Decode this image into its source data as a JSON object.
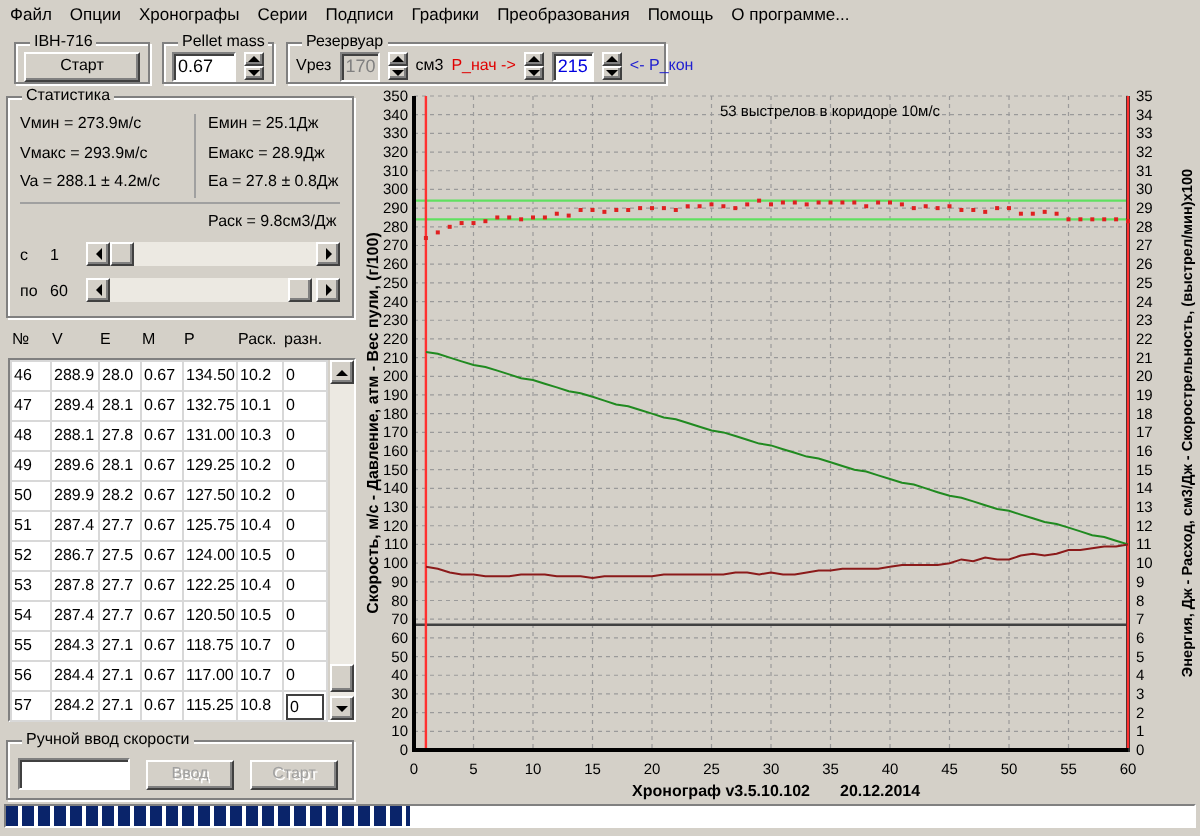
{
  "menu": [
    "Файл",
    "Опции",
    "Хронографы",
    "Серии",
    "Подписи",
    "Графики",
    "Преобразования",
    "Помощь",
    "О программе..."
  ],
  "device": {
    "title": "IBH-716",
    "button": "Старт"
  },
  "pellet_mass": {
    "title": "Pellet mass",
    "value": "0.67"
  },
  "reservoir": {
    "title": "Резервуар",
    "volume_label": "Vрез",
    "volume": "170",
    "volume_disabled": true,
    "unit": "см3",
    "p_start_label": "P_нач ->",
    "p_end": "215",
    "p_end_label": "<- P_кон"
  },
  "statistics": {
    "title": "Статистика",
    "velocity": [
      "Vмин = 273.9м/с",
      "Vмакс = 293.9м/с",
      "Va = 288.1 ± 4.2м/с"
    ],
    "energy": [
      "Емин = 25.1Дж",
      "Емакс = 28.9Дж",
      "Еа = 27.8 ± 0.8Дж"
    ],
    "consumption": "Раск = 9.8см3/Дж",
    "range": [
      {
        "label": "с",
        "value": "1",
        "level": 0
      },
      {
        "label": "по",
        "value": "60",
        "level": 1
      }
    ]
  },
  "table": {
    "columns": [
      "№",
      "V",
      "E",
      "M",
      "P",
      "Раск.",
      "разн."
    ],
    "rows": [
      {
        "cells": [
          "46",
          "288.9",
          "28.0",
          "0.67",
          "134.50",
          "10.2",
          "0"
        ],
        "editing": false
      },
      {
        "cells": [
          "47",
          "289.4",
          "28.1",
          "0.67",
          "132.75",
          "10.1",
          "0"
        ],
        "editing": false
      },
      {
        "cells": [
          "48",
          "288.1",
          "27.8",
          "0.67",
          "131.00",
          "10.3",
          "0"
        ],
        "editing": false
      },
      {
        "cells": [
          "49",
          "289.6",
          "28.1",
          "0.67",
          "129.25",
          "10.2",
          "0"
        ],
        "editing": false
      },
      {
        "cells": [
          "50",
          "289.9",
          "28.2",
          "0.67",
          "127.50",
          "10.2",
          "0"
        ],
        "editing": false
      },
      {
        "cells": [
          "51",
          "287.4",
          "27.7",
          "0.67",
          "125.75",
          "10.4",
          "0"
        ],
        "editing": false
      },
      {
        "cells": [
          "52",
          "286.7",
          "27.5",
          "0.67",
          "124.00",
          "10.5",
          "0"
        ],
        "editing": false
      },
      {
        "cells": [
          "53",
          "287.8",
          "27.7",
          "0.67",
          "122.25",
          "10.4",
          "0"
        ],
        "editing": false
      },
      {
        "cells": [
          "54",
          "287.4",
          "27.7",
          "0.67",
          "120.50",
          "10.5",
          "0"
        ],
        "editing": false
      },
      {
        "cells": [
          "55",
          "284.3",
          "27.1",
          "0.67",
          "118.75",
          "10.7",
          "0"
        ],
        "editing": false
      },
      {
        "cells": [
          "56",
          "284.4",
          "27.1",
          "0.67",
          "117.00",
          "10.7",
          "0"
        ],
        "editing": false
      },
      {
        "cells": [
          "57",
          "284.2",
          "27.1",
          "0.67",
          "115.25",
          "10.8",
          "0"
        ],
        "editing": true
      }
    ]
  },
  "manual_entry": {
    "title": "Ручной ввод скорости",
    "buttons": [
      {
        "label": "Ввод",
        "disabled": true
      },
      {
        "label": "Старт",
        "disabled": true
      }
    ]
  },
  "chart": {
    "chart_data": {
      "type": "line",
      "xlabel": "Хронограф v3.5.10.102",
      "ylabel": "Скорость, м/с - Давление, атм - Вес пули, (г/100)",
      "xlim": [
        0,
        60
      ],
      "ylim": [
        0,
        350
      ],
      "xticks": [
        0,
        5,
        10,
        15,
        20,
        25,
        30,
        35,
        40,
        45,
        50,
        55,
        60
      ],
      "yticks": [
        0,
        10,
        20,
        30,
        40,
        50,
        60,
        70,
        80,
        90,
        100,
        110,
        120,
        130,
        140,
        150,
        160,
        170,
        180,
        190,
        200,
        210,
        220,
        230,
        240,
        250,
        260,
        270,
        280,
        290,
        300,
        310,
        320,
        330,
        340,
        350
      ],
      "x": [
        1,
        2,
        3,
        4,
        5,
        6,
        7,
        8,
        9,
        10,
        11,
        12,
        13,
        14,
        15,
        16,
        17,
        18,
        19,
        20,
        21,
        22,
        23,
        24,
        25,
        26,
        27,
        28,
        29,
        30,
        31,
        32,
        33,
        34,
        35,
        36,
        37,
        38,
        39,
        40,
        41,
        42,
        43,
        44,
        45,
        46,
        47,
        48,
        49,
        50,
        51,
        52,
        53,
        54,
        55,
        56,
        57,
        58,
        59,
        60
      ],
      "series": [
        {
          "type": "scatter",
          "color": "#e02020",
          "values": [
            274,
            277,
            280,
            282,
            282,
            283,
            285,
            285,
            284,
            285,
            285,
            287,
            286,
            289,
            289,
            288,
            289,
            289,
            290,
            290,
            290,
            289,
            291,
            291,
            292,
            291,
            290,
            292,
            294,
            292,
            293,
            293,
            292,
            293,
            293,
            293,
            293,
            291,
            293,
            293,
            292,
            290,
            291,
            290,
            291,
            289,
            289,
            288,
            290,
            290,
            287,
            287,
            288,
            287,
            284,
            284,
            284,
            284,
            284,
            283
          ]
        },
        {
          "type": "line",
          "color": "#208a20",
          "values": [
            213,
            212,
            210,
            208,
            206,
            205,
            203,
            201,
            199,
            198,
            196,
            194,
            192,
            191,
            189,
            187,
            185,
            184,
            182,
            180,
            178,
            177,
            175,
            173,
            171,
            170,
            168,
            166,
            164,
            163,
            161,
            159,
            157,
            156,
            154,
            152,
            150,
            149,
            147,
            145,
            143,
            142,
            140,
            138,
            136,
            135,
            133,
            131,
            129,
            128,
            126,
            124,
            122,
            121,
            119,
            117,
            115,
            114,
            112,
            110
          ]
        },
        {
          "type": "line",
          "color": "#8b1a1a",
          "values": [
            98,
            97,
            95,
            94,
            94,
            93,
            93,
            93,
            94,
            94,
            94,
            93,
            93,
            93,
            92,
            93,
            93,
            93,
            93,
            93,
            94,
            94,
            94,
            94,
            94,
            94,
            95,
            95,
            94,
            95,
            94,
            94,
            95,
            96,
            96,
            97,
            97,
            97,
            97,
            98,
            99,
            99,
            99,
            99,
            100,
            102,
            101,
            103,
            102,
            102,
            104,
            105,
            104,
            105,
            107,
            107,
            108,
            109,
            109,
            110
          ]
        }
      ],
      "grid": true,
      "ref_lines": [
        {
          "axis": "y",
          "value": 284,
          "color": "#60e060"
        },
        {
          "axis": "y",
          "value": 294,
          "color": "#60e060"
        },
        {
          "axis": "y",
          "value": 67,
          "color": "#404040"
        },
        {
          "axis": "x",
          "value": 1,
          "color": "#ff3030"
        },
        {
          "axis": "x",
          "value": 60,
          "color": "#ff3030"
        }
      ],
      "annotations": [
        "53 выстрелов в коридоре 10м/с"
      ]
    },
    "date": "20.12.2014",
    "right_axis": {
      "label": "Энергия, Дж - Расход, см3/Дж - Скорострельность, (выстрел/мин)x100",
      "ticks": [
        "35",
        "34",
        "33",
        "32",
        "31",
        "30",
        "29",
        "28",
        "27",
        "26",
        "25",
        "24",
        "23",
        "22",
        "21",
        "20",
        "19",
        "18",
        "17",
        "16",
        "15",
        "14",
        "13",
        "12",
        "11",
        "10",
        "9",
        "8",
        "7",
        "6",
        "5",
        "4",
        "3",
        "2",
        "1",
        "0"
      ]
    }
  },
  "progress": {
    "level": 0.34
  }
}
